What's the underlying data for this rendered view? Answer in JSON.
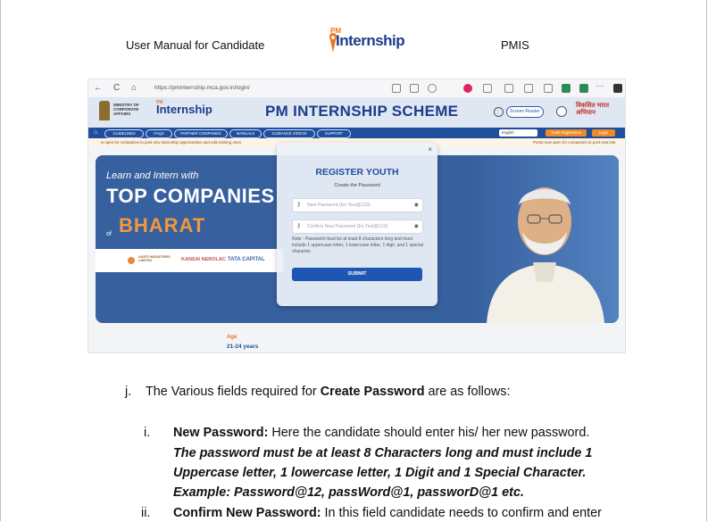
{
  "header": {
    "left": "User Manual for Candidate",
    "logo_pm": "PM",
    "logo_word": "Internship",
    "right": "PMIS"
  },
  "screenshot": {
    "browser": {
      "url": "https://pminternship.mca.gov.in/login/",
      "nav_back": "←",
      "nav_reload": "C",
      "nav_home": "⌂",
      "menu": "···"
    },
    "site": {
      "ministry": [
        "MINISTRY OF",
        "CORPORATE",
        "AFFAIRS"
      ],
      "logo_pm": "PM",
      "logo_word": "Internship",
      "scheme_title": "PM INTERNSHIP SCHEME",
      "screen_reader": "Screen Reader",
      "hindi_brand": [
        "विकसित भारत",
        "अभियान"
      ]
    },
    "navbar": {
      "items": [
        "GUIDELINES",
        "FAQS",
        "PARTNER COMPANIES",
        "MANUALS",
        "GUIDANCE VIDEOS",
        "SUPPORT"
      ],
      "language": "English",
      "youth_button": "Youth Registration",
      "login_button": "Login"
    },
    "ticker": {
      "left": "w open for companies to post new internship opportunities and edit existing ones",
      "right": "Portal now open for companies to post new inte"
    },
    "hero": {
      "learn": "Learn and Intern with",
      "top_companies": "TOP COMPANIES",
      "of": "of",
      "bharat": "BHARAT",
      "brands": [
        "AARTI INDUSTRIES LIMITED",
        "KANSAI NEROLAC",
        "TATA CAPITAL"
      ]
    },
    "modal": {
      "close": "×",
      "title": "REGISTER YOUTH",
      "subtitle": "Create the Password",
      "new_password_placeholder": "New Password (Ex-Test@123)",
      "confirm_password_placeholder": "Confirm New Password (Ex-Test@123)",
      "note": "Note : Password must be at least 8 characters long and must include 1 uppercase letter, 1 lowercase letter, 1 digit, and 1 special character.",
      "submit": "SUBMIT"
    },
    "age": {
      "label": "Age",
      "value": "21-24 years"
    }
  },
  "body": {
    "j_marker": "j.",
    "j_text_pre": "The Various fields required for ",
    "j_text_bold": "Create Password",
    "j_text_post": " are as follows:",
    "i_marker": "i.",
    "i_label": "New Password:",
    "i_text": " Here the candidate should enter his/ her new password.",
    "i_rule_1": "The password must be at least 8 Characters long and must include 1",
    "i_rule_2": "Uppercase letter, 1 lowercase letter, 1 Digit and 1 Special Character.",
    "i_rule_3": "Example: Password@12, passWord@1, passworD@1 etc.",
    "ii_marker": "ii.",
    "ii_label": "Confirm New Password:",
    "ii_text": " In this field candidate needs to confirm and enter"
  }
}
